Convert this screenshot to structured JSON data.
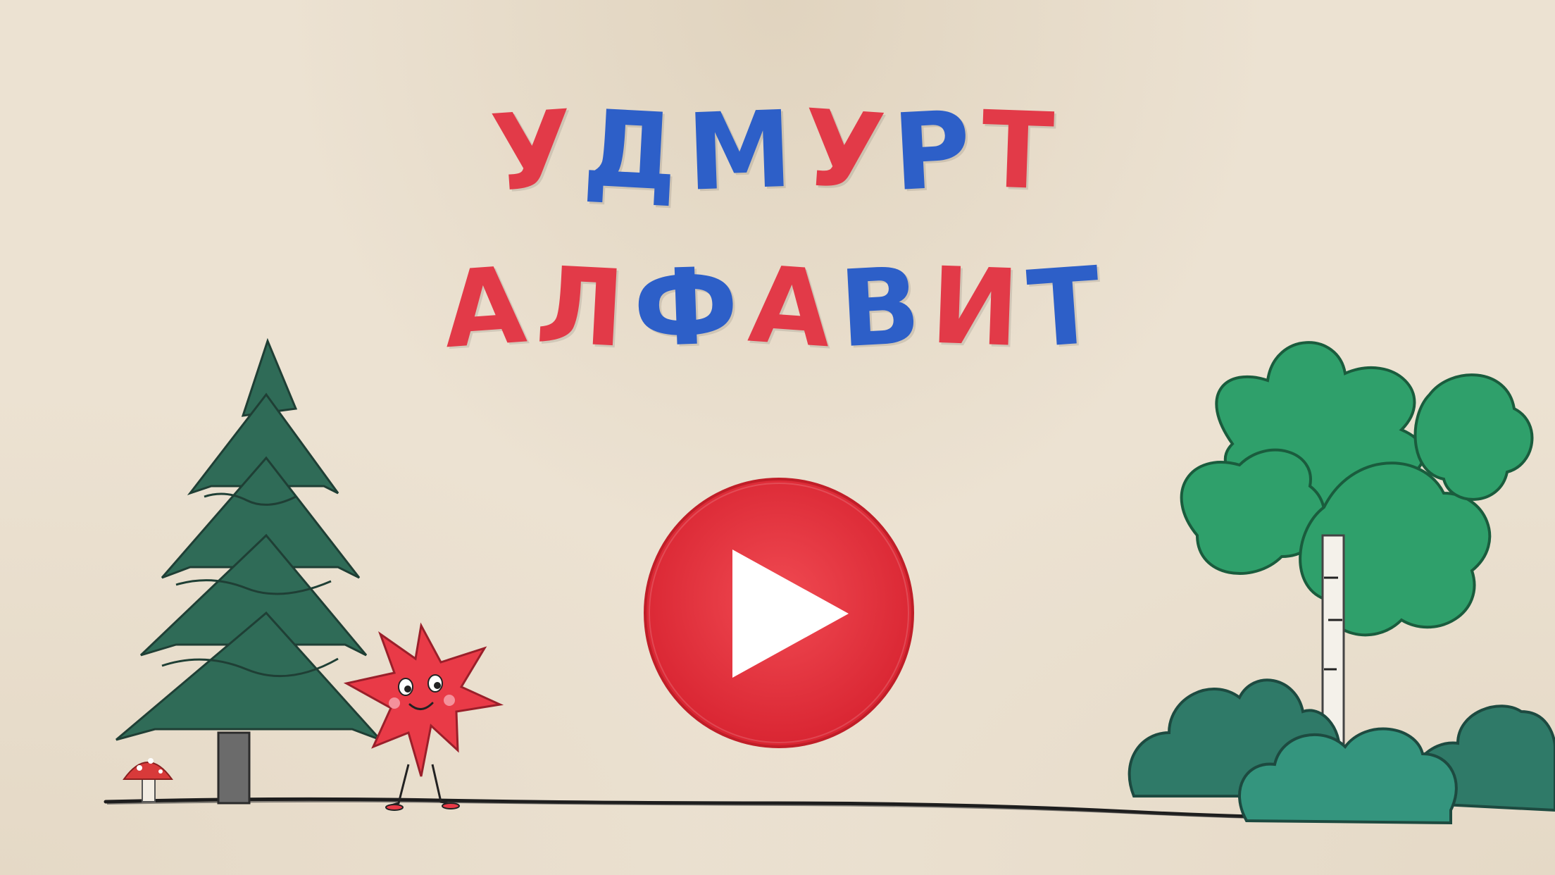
{
  "title": {
    "line1": "УДМУРТ",
    "line2": "АЛФАВИТ",
    "line1_colors": [
      "red",
      "blue",
      "blue",
      "red",
      "blue",
      "red",
      "blue"
    ],
    "line2_colors": [
      "red",
      "red",
      "blue",
      "red",
      "blue",
      "red",
      "blue"
    ]
  },
  "colors": {
    "red": "#e23a48",
    "blue": "#2d5fc8",
    "play_red": "#e1323c",
    "play_white": "#ffffff",
    "spruce": "#2f6b57",
    "bush_dark": "#2f7a68",
    "bush_teal": "#34957e",
    "birch_green": "#2fa06b",
    "ground": "#1c1c1c",
    "star_red": "#e93a47",
    "mushroom_cap": "#d83a3a"
  },
  "icons": {
    "play": "play-icon",
    "spruce": "spruce-tree-icon",
    "birch": "birch-tree-icon",
    "bushes": "bush-icon",
    "mushroom": "mushroom-icon",
    "mascot": "star-mascot-icon"
  }
}
